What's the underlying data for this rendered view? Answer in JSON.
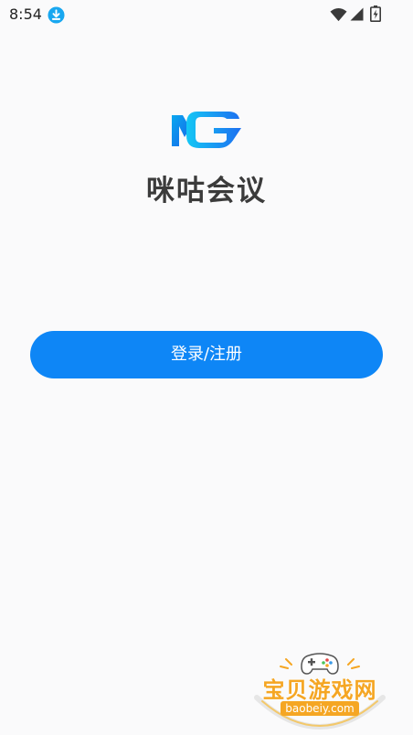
{
  "status_bar": {
    "time": "8:54",
    "icons": [
      "download-icon",
      "wifi-icon",
      "signal-icon",
      "battery-icon"
    ]
  },
  "app": {
    "logo_icon": "mg-logo-icon",
    "name": "咪咕会议"
  },
  "login_button": {
    "label": "登录/注册"
  },
  "watermark": {
    "title": "宝贝游戏网",
    "url": "baobeiy.com",
    "icon": "gamepad-icon"
  },
  "colors": {
    "background": "#fafafb",
    "primary": "#0e86f6",
    "title_text": "#3b3b3b",
    "watermark_accent": "#f5a623"
  }
}
